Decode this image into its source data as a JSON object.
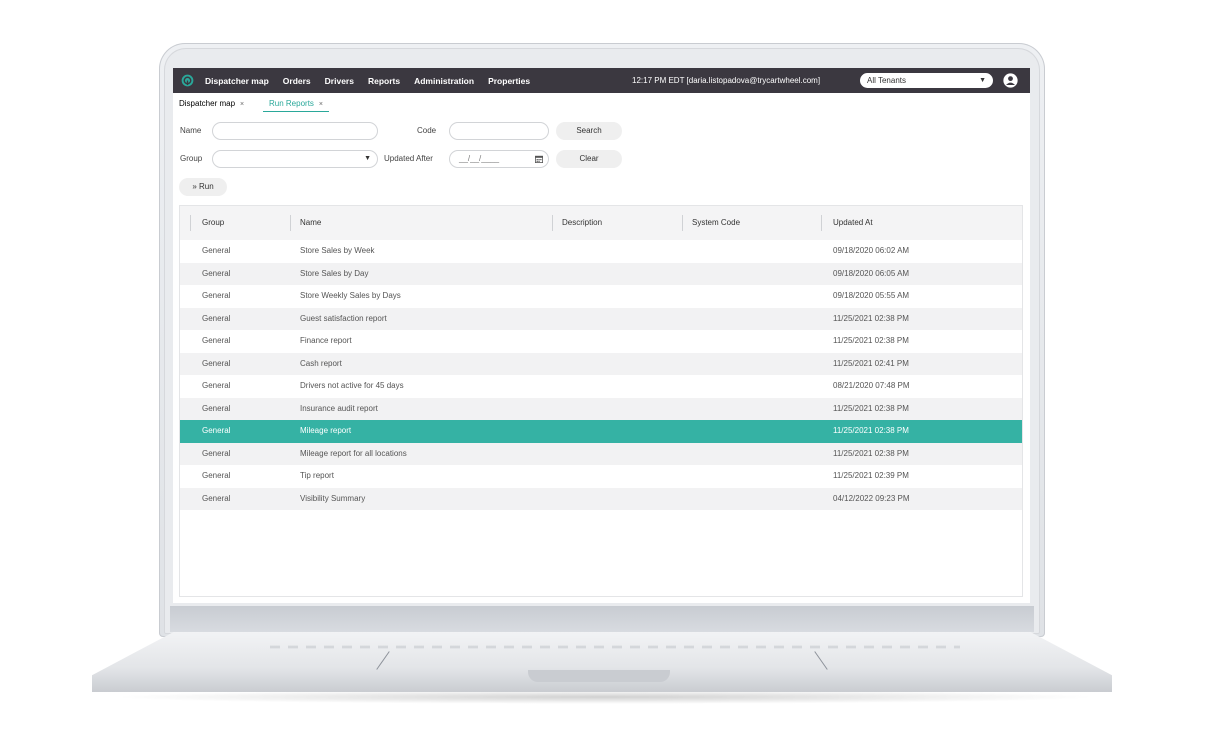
{
  "topnav": {
    "items": [
      "Dispatcher map",
      "Orders",
      "Drivers",
      "Reports",
      "Administration",
      "Properties"
    ],
    "time": "12:17 PM  EDT  [daria.listopadova@trycartwheel.com]",
    "tenant": "All Tenants"
  },
  "tabs": [
    {
      "label": "Dispatcher map",
      "close": "×"
    },
    {
      "label": "Run Reports",
      "close": "×"
    }
  ],
  "filters": {
    "name_label": "Name",
    "code_label": "Code",
    "group_label": "Group",
    "updated_after_label": "Updated After",
    "date_placeholder": "__/__/____",
    "search_button": "Search",
    "clear_button": "Clear",
    "run_button": "» Run"
  },
  "table": {
    "headers": [
      "Group",
      "Name",
      "Description",
      "System Code",
      "Updated At"
    ],
    "rows": [
      {
        "group": "General",
        "name": "Store Sales by Week",
        "description": "",
        "code": "",
        "updated": "09/18/2020 06:02 AM"
      },
      {
        "group": "General",
        "name": "Store Sales by Day",
        "description": "",
        "code": "",
        "updated": "09/18/2020 06:05 AM"
      },
      {
        "group": "General",
        "name": "Store Weekly Sales by Days",
        "description": "",
        "code": "",
        "updated": "09/18/2020 05:55 AM"
      },
      {
        "group": "General",
        "name": "Guest satisfaction report",
        "description": "",
        "code": "",
        "updated": "11/25/2021 02:38 PM"
      },
      {
        "group": "General",
        "name": "Finance report",
        "description": "",
        "code": "",
        "updated": "11/25/2021 02:38 PM"
      },
      {
        "group": "General",
        "name": "Cash report",
        "description": "",
        "code": "",
        "updated": "11/25/2021 02:41 PM"
      },
      {
        "group": "General",
        "name": "Drivers not active for 45 days",
        "description": "",
        "code": "",
        "updated": "08/21/2020 07:48 PM"
      },
      {
        "group": "General",
        "name": "Insurance audit report",
        "description": "",
        "code": "",
        "updated": "11/25/2021 02:38 PM"
      },
      {
        "group": "General",
        "name": "Mileage report",
        "description": "",
        "code": "",
        "updated": "11/25/2021 02:38 PM"
      },
      {
        "group": "General",
        "name": "Mileage report for all locations",
        "description": "",
        "code": "",
        "updated": "11/25/2021 02:38 PM"
      },
      {
        "group": "General",
        "name": "Tip report",
        "description": "",
        "code": "",
        "updated": "11/25/2021 02:39 PM"
      },
      {
        "group": "General",
        "name": "Visibility Summary",
        "description": "",
        "code": "",
        "updated": "04/12/2022 09:23 PM"
      }
    ],
    "selected_row": 8
  },
  "colors": {
    "accent": "#2aa89a",
    "nav_bg": "#3b3840",
    "selected_row": "#35b2a4"
  }
}
